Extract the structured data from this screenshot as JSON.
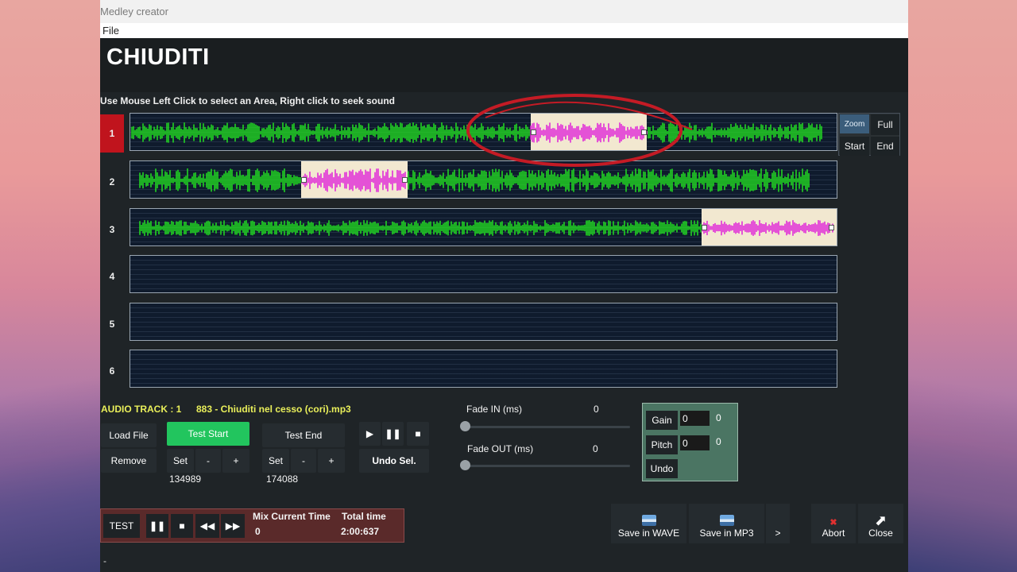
{
  "window": {
    "title": "Medley creator"
  },
  "menu": {
    "file": "File"
  },
  "header": {
    "song_title": "CHIUDITI"
  },
  "instruction": "Use Mouse Left Click to select an Area, Right click to seek sound",
  "tracks": [
    {
      "number": "1",
      "active": true
    },
    {
      "number": "2",
      "active": false
    },
    {
      "number": "3",
      "active": false
    },
    {
      "number": "4",
      "active": false
    },
    {
      "number": "5",
      "active": false
    },
    {
      "number": "6",
      "active": false
    }
  ],
  "zoom": {
    "label": "Zoom",
    "full": "Full",
    "start": "Start",
    "end": "End"
  },
  "audio_track": {
    "label": "AUDIO TRACK : 1",
    "filename": "883 - Chiuditi nel cesso (cori).mp3"
  },
  "controls": {
    "load_file": "Load File",
    "remove": "Remove",
    "test_start": "Test Start",
    "test_end": "Test End",
    "set": "Set",
    "minus": "-",
    "plus": "+",
    "start_value": "134989",
    "end_value": "174088",
    "undo_sel": "Undo Sel."
  },
  "fade": {
    "in_label": "Fade IN (ms)",
    "in_value": "0",
    "out_label": "Fade OUT (ms)",
    "out_value": "0"
  },
  "gain_panel": {
    "gain_label": "Gain",
    "gain_input": "0",
    "gain_value": "0",
    "pitch_label": "Pitch",
    "pitch_input": "0",
    "pitch_value": "0",
    "undo_label": "Undo"
  },
  "transport": {
    "test": "TEST",
    "mix_current_label": "Mix Current Time",
    "mix_current_value": "0",
    "total_label": "Total time",
    "total_value": "2:00:637"
  },
  "actions": {
    "save_wave": "Save in WAVE",
    "save_mp3": "Save in MP3",
    "more": ">",
    "abort": "Abort",
    "close": "Close"
  },
  "status": {
    "text": "-"
  },
  "colors": {
    "waveform": "#22e022",
    "selection_wave": "#e020d8",
    "active_track": "#c0141d",
    "annotation_circle": "#c41b25"
  }
}
